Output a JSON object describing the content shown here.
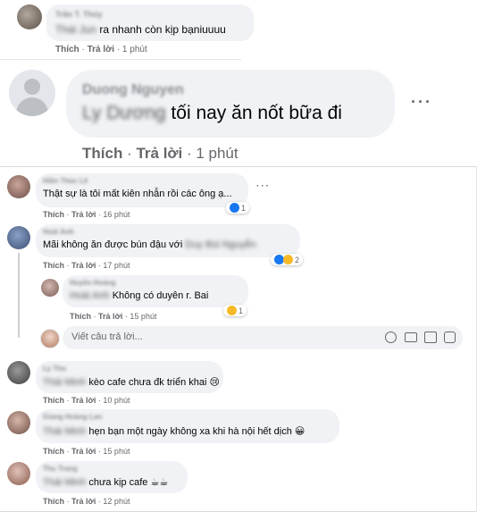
{
  "top_comment": {
    "name": "Trần T. Thủy",
    "mention": "Thái Jun",
    "text": " ra nhanh còn kịp bạniuuuu",
    "like": "Thích",
    "reply": "Trả lời",
    "time": "1 phút"
  },
  "large_comment": {
    "name": "Duong Nguyen",
    "mention": "Ly Dương",
    "text": " tối nay ăn nốt bữa đi",
    "like": "Thích",
    "reply": "Trả lời",
    "time": "1 phút",
    "more": "···"
  },
  "comments": [
    {
      "name": "Hiền Thúc Lê",
      "text": "Thật sự là tôi mất kiên nhẫn rồi các ông ạ...",
      "like": "Thích",
      "reply": "Trả lời",
      "time": "16 phút",
      "reaction_count": "1",
      "more": "···"
    },
    {
      "name": "Hoài Anh",
      "text": "Mãi không ăn được bún đậu với ",
      "mention": "Duy Bùi Nguyễn",
      "like": "Thích",
      "reply": "Trả lời",
      "time": "17 phút",
      "reaction_count": "2"
    },
    {
      "name": "Huyền Hoàng",
      "mention": "Hoài Anh",
      "text": " Không có duyên r. Bai",
      "like": "Thích",
      "reply": "Trả lời",
      "time": "15 phút",
      "reaction_count": "1"
    },
    {
      "name": "Ly Thu",
      "mention": "Thái Minh",
      "text": " kèo cafe chưa đk triển khai 😢",
      "like": "Thích",
      "reply": "Trả lời",
      "time": "10 phút"
    },
    {
      "name": "Giang Hoàng Lan",
      "mention": "Thái Minh",
      "text": " hẹn bạn một ngày không xa khi hà nội hết dịch 😀",
      "like": "Thích",
      "reply": "Trả lời",
      "time": "15 phút"
    },
    {
      "name": "Thu Trang",
      "mention": "Thái Minh",
      "text": " chưa kịp cafe ☕☕",
      "like": "Thích",
      "reply": "Trả lời",
      "time": "12 phút"
    }
  ],
  "reply_box": {
    "placeholder": "Viết câu trả lời..."
  },
  "colors": {
    "bubble": "#f0f2f5",
    "meta": "#65676b",
    "text": "#050505",
    "like_blue": "#1877f2",
    "haha_yellow": "#f7b928"
  },
  "icons": [
    "smiley-icon",
    "camera-icon",
    "gif-icon",
    "sticker-icon",
    "more-options-icon",
    "like-reaction-icon",
    "haha-reaction-icon",
    "sad-reaction-icon"
  ]
}
